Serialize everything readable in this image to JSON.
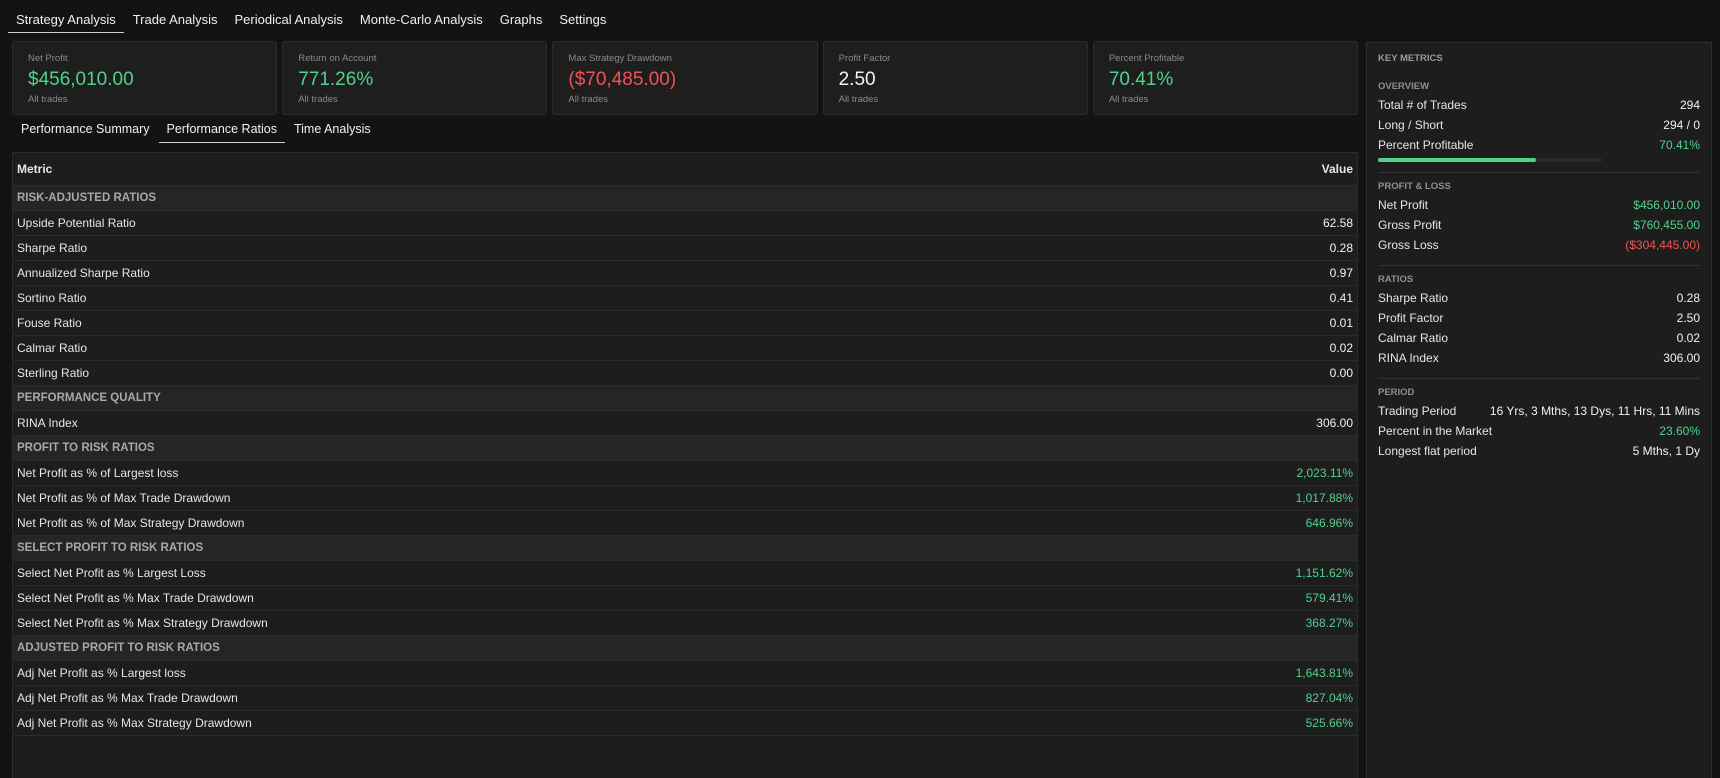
{
  "top_tabs": [
    "Strategy Analysis",
    "Trade Analysis",
    "Periodical Analysis",
    "Monte-Carlo Analysis",
    "Graphs",
    "Settings"
  ],
  "cards": [
    {
      "label": "Net Profit",
      "value": "$456,010.00",
      "sub": "All trades",
      "color": "#4fd28e"
    },
    {
      "label": "Return on Account",
      "value": "771.26%",
      "sub": "All trades",
      "color": "#4fd28e"
    },
    {
      "label": "Max Strategy Drawdown",
      "value": "($70,485.00)",
      "sub": "All trades",
      "color": "#f05353"
    },
    {
      "label": "Profit Factor",
      "value": "2.50",
      "sub": "All trades",
      "color": "#f2f2f2"
    },
    {
      "label": "Percent Profitable",
      "value": "70.41%",
      "sub": "All trades",
      "color": "#4fd28e"
    }
  ],
  "sub_tabs": [
    "Performance Summary",
    "Performance Ratios",
    "Time Analysis"
  ],
  "table": {
    "header": {
      "metric": "Metric",
      "value": "Value"
    },
    "rows": [
      {
        "type": "section",
        "label": "RISK-ADJUSTED RATIOS"
      },
      {
        "type": "row",
        "label": "Upside Potential Ratio",
        "value": "62.58",
        "tone": "white"
      },
      {
        "type": "row",
        "label": "Sharpe Ratio",
        "value": "0.28",
        "tone": "white"
      },
      {
        "type": "row",
        "label": "Annualized Sharpe Ratio",
        "value": "0.97",
        "tone": "white"
      },
      {
        "type": "row",
        "label": "Sortino Ratio",
        "value": "0.41",
        "tone": "white"
      },
      {
        "type": "row",
        "label": "Fouse Ratio",
        "value": "0.01",
        "tone": "white"
      },
      {
        "type": "row",
        "label": "Calmar Ratio",
        "value": "0.02",
        "tone": "white"
      },
      {
        "type": "row",
        "label": "Sterling Ratio",
        "value": "0.00",
        "tone": "white"
      },
      {
        "type": "section",
        "label": "PERFORMANCE QUALITY"
      },
      {
        "type": "row",
        "label": "RINA Index",
        "value": "306.00",
        "tone": "white"
      },
      {
        "type": "section",
        "label": "PROFIT TO RISK RATIOS"
      },
      {
        "type": "row",
        "label": "Net Profit as % of Largest loss",
        "value": "2,023.11%",
        "tone": "green"
      },
      {
        "type": "row",
        "label": "Net Profit as % of Max Trade Drawdown",
        "value": "1,017.88%",
        "tone": "green"
      },
      {
        "type": "row",
        "label": "Net Profit as % of Max Strategy Drawdown",
        "value": "646.96%",
        "tone": "green"
      },
      {
        "type": "section",
        "label": "SELECT PROFIT TO RISK RATIOS"
      },
      {
        "type": "row",
        "label": "Select Net Profit  as % Largest Loss",
        "value": "1,151.62%",
        "tone": "green"
      },
      {
        "type": "row",
        "label": "Select Net Profit as % Max Trade Drawdown",
        "value": "579.41%",
        "tone": "green"
      },
      {
        "type": "row",
        "label": "Select Net Profit as % Max Strategy Drawdown",
        "value": "368.27%",
        "tone": "green"
      },
      {
        "type": "section",
        "label": "ADJUSTED PROFIT TO RISK RATIOS"
      },
      {
        "type": "row",
        "label": "Adj Net Profit as % Largest loss",
        "value": "1,643.81%",
        "tone": "green"
      },
      {
        "type": "row",
        "label": "Adj Net Profit as % Max Trade Drawdown",
        "value": "827.04%",
        "tone": "green"
      },
      {
        "type": "row",
        "label": "Adj Net Profit as % Max Strategy Drawdown",
        "value": "525.66%",
        "tone": "green"
      }
    ]
  },
  "sidebar": {
    "title": "KEY METRICS",
    "sections": [
      {
        "title": "OVERVIEW",
        "rows": [
          {
            "label": "Total # of Trades",
            "value": "294",
            "tone": "white"
          },
          {
            "label": "Long / Short",
            "value": "294 / 0",
            "tone": "white"
          },
          {
            "label": "Percent Profitable",
            "value": "70.41%",
            "tone": "green",
            "progress": 0.7041
          }
        ]
      },
      {
        "title": "PROFIT & LOSS",
        "rows": [
          {
            "label": "Net Profit",
            "value": "$456,010.00",
            "tone": "green"
          },
          {
            "label": "Gross Profit",
            "value": "$760,455.00",
            "tone": "green"
          },
          {
            "label": "Gross Loss",
            "value": "($304,445.00)",
            "tone": "red"
          }
        ]
      },
      {
        "title": "RATIOS",
        "rows": [
          {
            "label": "Sharpe Ratio",
            "value": "0.28",
            "tone": "white"
          },
          {
            "label": "Profit Factor",
            "value": "2.50",
            "tone": "white"
          },
          {
            "label": "Calmar Ratio",
            "value": "0.02",
            "tone": "white"
          },
          {
            "label": "RINA Index",
            "value": "306.00",
            "tone": "white"
          }
        ]
      },
      {
        "title": "PERIOD",
        "rows": [
          {
            "label": "Trading Period",
            "value": "16 Yrs, 3 Mths, 13 Dys, 11 Hrs, 11 Mins",
            "tone": "white"
          },
          {
            "label": "Percent in the Market",
            "value": "23.60%",
            "tone": "green"
          },
          {
            "label": "Longest flat period",
            "value": "5 Mths, 1 Dy",
            "tone": "white"
          }
        ]
      }
    ]
  },
  "colors": {
    "accent_green": "#4fd28e",
    "accent_red": "#f05353",
    "background": "#131313",
    "panel": "#1d1d1d"
  }
}
